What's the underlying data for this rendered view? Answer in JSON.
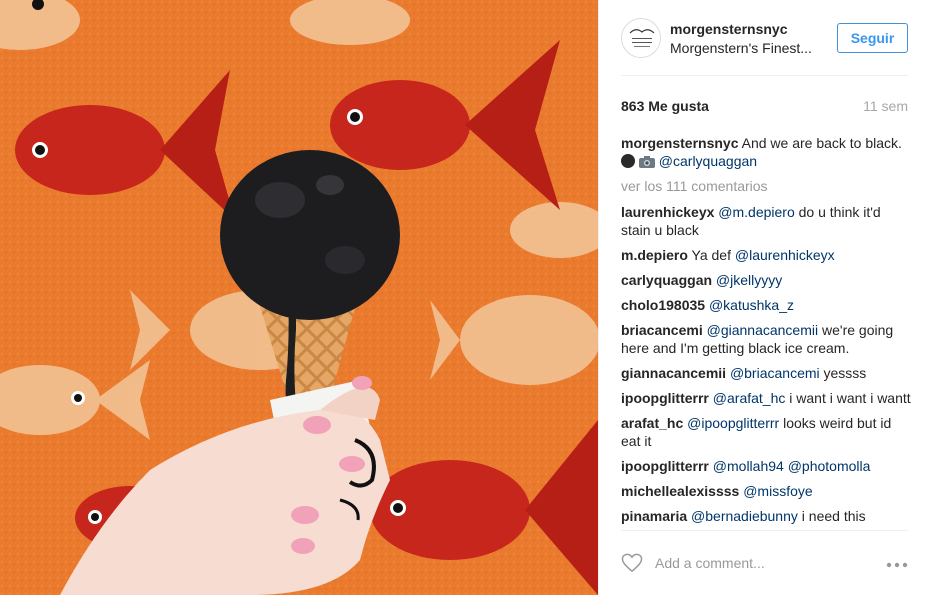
{
  "post": {
    "username": "morgensternsnyc",
    "location": "Morgenstern's Finest...",
    "follow_label": "Seguir",
    "likes": "863 Me gusta",
    "time": "11 sem",
    "view_all": "ver los 111 comentarios",
    "add_comment_placeholder": "Add a comment..."
  },
  "caption": {
    "user": "morgensternsnyc",
    "text_before": "And we are back to black.",
    "mention": "@carlyquaggan"
  },
  "comments": [
    {
      "user": "laurenhickeyx",
      "mention": "@m.depiero",
      "text": "do u think it'd stain u black"
    },
    {
      "user": "m.depiero",
      "text_before": "Ya def",
      "mention": "@laurenhickeyx",
      "text": ""
    },
    {
      "user": "carlyquaggan",
      "mention": "@jkellyyyy",
      "text": ""
    },
    {
      "user": "cholo198035",
      "mention": "@katushka_z",
      "text": ""
    },
    {
      "user": "briacancemi",
      "mention": "@giannacancemii",
      "text": "we're going here and I'm getting black ice cream."
    },
    {
      "user": "giannacancemii",
      "mention": "@briacancemi",
      "text": "yessss"
    },
    {
      "user": "ipoopglitterrr",
      "mention": "@arafat_hc",
      "text": "i want i want i wantt"
    },
    {
      "user": "arafat_hc",
      "mention": "@ipoopglitterrr",
      "text": "looks weird but id eat it"
    },
    {
      "user": "ipoopglitterrr",
      "mention": "@mollah94 @photomolla",
      "text": ""
    },
    {
      "user": "michellealexissss",
      "mention": "@missfoye",
      "text": ""
    },
    {
      "user": "pinamaria",
      "mention": "@bernadiebunny",
      "text": "i need this"
    }
  ],
  "icons": {
    "heart": "heart-icon",
    "more": "more-options-icon",
    "avatar": "morgenstern-logo",
    "emoji1": "black-circle-emoji",
    "emoji2": "camera-emoji"
  },
  "colors": {
    "follow_blue": "#3897f0",
    "mention_blue": "#003569",
    "wall_orange": "#ea7a2e"
  }
}
